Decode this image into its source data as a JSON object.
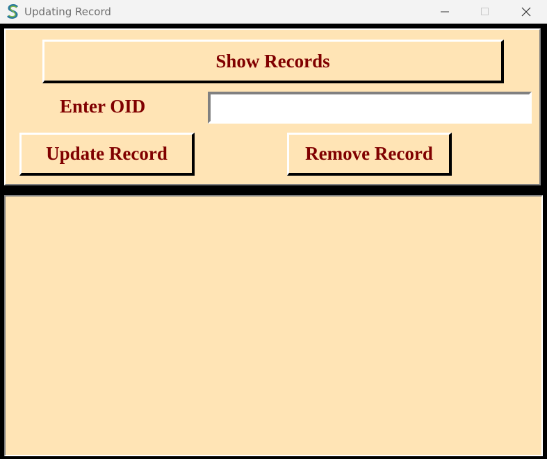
{
  "window": {
    "title": "Updating Record",
    "app_icon": "s-logo-icon",
    "controls": {
      "minimize_icon": "minimize-icon",
      "maximize_icon": "maximize-icon",
      "close_icon": "close-icon"
    }
  },
  "form": {
    "show_records_label": "Show Records",
    "oid_label": "Enter OID",
    "oid_value": "",
    "update_label": "Update Record",
    "remove_label": "Remove Record"
  },
  "colors": {
    "panel_background": "#ffe4b5",
    "text_color": "#800000",
    "frame_background": "#000000"
  }
}
